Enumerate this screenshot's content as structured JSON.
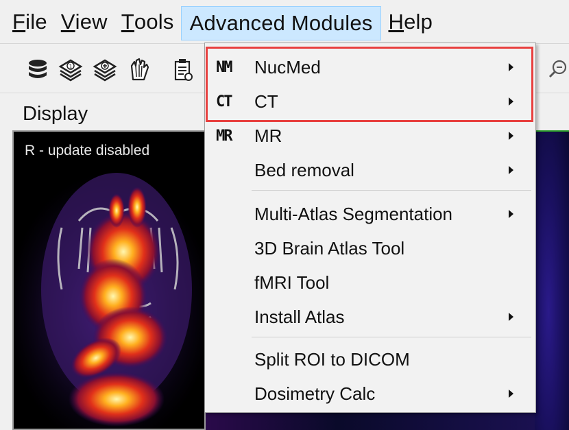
{
  "menubar": {
    "file": {
      "mnemonic": "F",
      "rest": "ile"
    },
    "view": {
      "mnemonic": "V",
      "rest": "iew"
    },
    "tools": {
      "mnemonic": "T",
      "rest": "ools"
    },
    "advanced": "Advanced Modules",
    "help": {
      "mnemonic": "H",
      "rest": "elp"
    }
  },
  "toolbar": {
    "icons": [
      "database-icon",
      "layers-one-icon",
      "layers-add-icon",
      "hand-icon",
      "clipboard-icon",
      "zoom-icon"
    ]
  },
  "display": {
    "title": "Display",
    "status": "R - update disabled"
  },
  "dropdown": {
    "items": [
      {
        "prefix": "NM",
        "label": "NucMed",
        "submenu": true
      },
      {
        "prefix": "CT",
        "label": "CT",
        "submenu": true
      },
      {
        "prefix": "MR",
        "label": "MR",
        "submenu": true
      },
      {
        "prefix": "",
        "label": "Bed removal",
        "submenu": true
      },
      {
        "prefix": "",
        "label": "Multi-Atlas Segmentation",
        "submenu": true
      },
      {
        "prefix": "",
        "label": "3D Brain Atlas Tool",
        "submenu": false
      },
      {
        "prefix": "",
        "label": "fMRI Tool",
        "submenu": false
      },
      {
        "prefix": "",
        "label": "Install Atlas",
        "submenu": true
      },
      {
        "prefix": "",
        "label": "Split ROI to DICOM",
        "submenu": false
      },
      {
        "prefix": "",
        "label": "Dosimetry Calc",
        "submenu": true
      }
    ]
  },
  "colors": {
    "highlight": "#e8403f",
    "menu_hover": "#cce8ff"
  }
}
